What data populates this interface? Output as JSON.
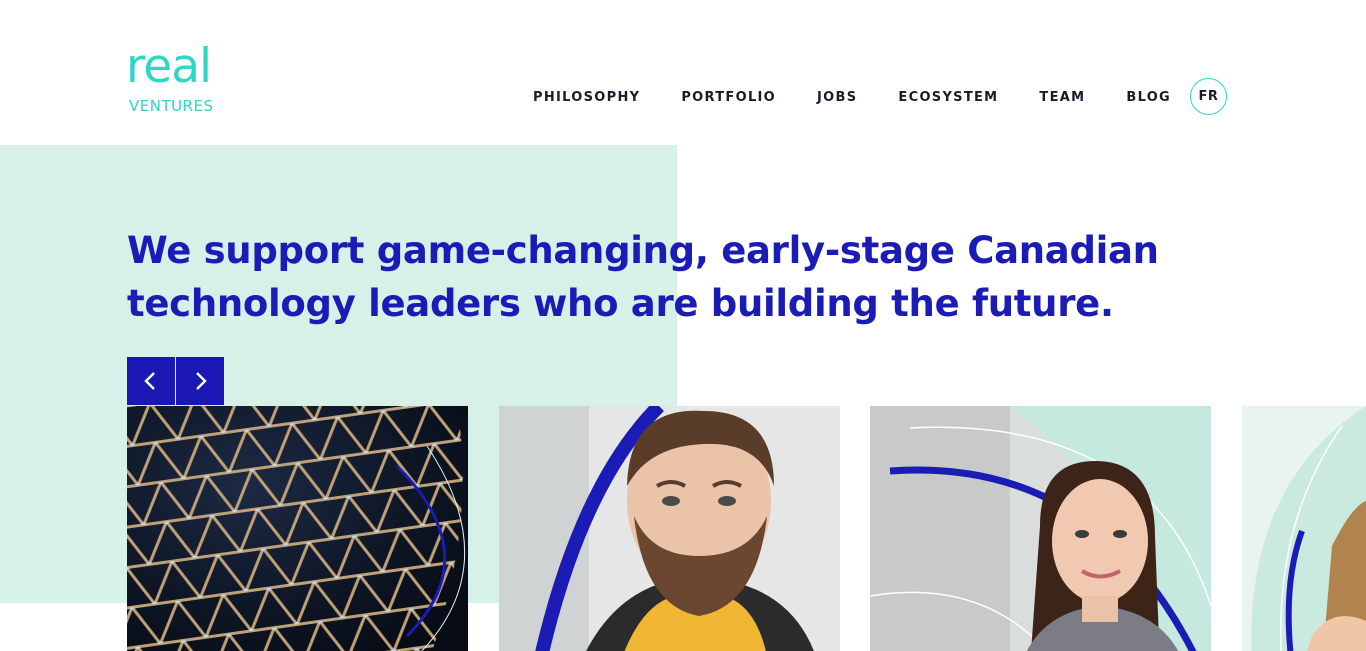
{
  "brand": {
    "logo_word": "real",
    "logo_subword": "VENTURES",
    "color": "#2fd6c5"
  },
  "nav": {
    "items": [
      {
        "label": "PHILOSOPHY"
      },
      {
        "label": "PORTFOLIO"
      },
      {
        "label": "JOBS"
      },
      {
        "label": "ECOSYSTEM"
      },
      {
        "label": "TEAM"
      },
      {
        "label": "BLOG"
      }
    ],
    "language_toggle": "FR"
  },
  "hero": {
    "headline": "We support game-changing, early-stage Canadian technology leaders who are building the future.",
    "accent_color": "#1b1cb5",
    "background_color": "#d7f0e8"
  },
  "carousel": {
    "prev_icon": "chevron-left-icon",
    "next_icon": "chevron-right-icon",
    "cards": [
      {
        "image": "geodesic-structure-photo"
      },
      {
        "image": "portrait-man-beard"
      },
      {
        "image": "portrait-woman-smiling"
      },
      {
        "image": "portrait-woman-partial"
      }
    ]
  }
}
